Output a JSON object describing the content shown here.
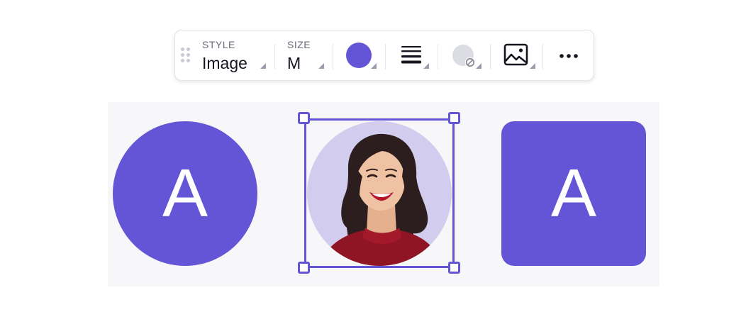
{
  "colors": {
    "accent": "#6355d6",
    "photo_bg": "#d2cdee",
    "canvas_bg": "#f7f7f9"
  },
  "toolbar": {
    "drag_handle_icon": "grip-dots-icon",
    "style": {
      "label": "STYLE",
      "value": "Image"
    },
    "size": {
      "label": "SIZE",
      "value": "M"
    },
    "color_swatch": "#6355d6",
    "align_icon": "text-align-justify-icon",
    "background_icon": "background-none-icon",
    "image_icon": "image-icon",
    "more_icon": "more-horizontal-icon"
  },
  "canvas": {
    "avatars": [
      {
        "kind": "letter",
        "shape": "circle",
        "letter": "A"
      },
      {
        "kind": "image",
        "shape": "circle",
        "selected": true
      },
      {
        "kind": "letter",
        "shape": "rounded-square",
        "letter": "A"
      }
    ]
  }
}
